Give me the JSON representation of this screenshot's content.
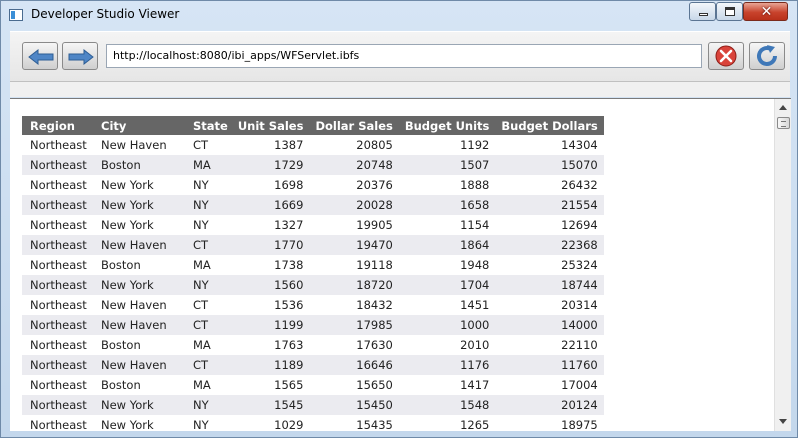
{
  "window": {
    "title": "Developer Studio Viewer"
  },
  "toolbar": {
    "url": "http://localhost:8080/ibi_apps/WFServlet.ibfs"
  },
  "colors": {
    "header_bg": "#666666",
    "row_alt": "#ebebf0",
    "close_red": "#c8432c"
  },
  "icons": {
    "back": "back-arrow-icon",
    "forward": "forward-arrow-icon",
    "stop": "stop-icon",
    "refresh": "refresh-icon"
  },
  "report": {
    "columns": [
      "Region",
      "City",
      "State",
      "Unit Sales",
      "Dollar Sales",
      "Budget Units",
      "Budget Dollars"
    ],
    "rows": [
      [
        "Northeast",
        "New Haven",
        "CT",
        "1387",
        "20805",
        "1192",
        "14304"
      ],
      [
        "Northeast",
        "Boston",
        "MA",
        "1729",
        "20748",
        "1507",
        "15070"
      ],
      [
        "Northeast",
        "New York",
        "NY",
        "1698",
        "20376",
        "1888",
        "26432"
      ],
      [
        "Northeast",
        "New York",
        "NY",
        "1669",
        "20028",
        "1658",
        "21554"
      ],
      [
        "Northeast",
        "New York",
        "NY",
        "1327",
        "19905",
        "1154",
        "12694"
      ],
      [
        "Northeast",
        "New Haven",
        "CT",
        "1770",
        "19470",
        "1864",
        "22368"
      ],
      [
        "Northeast",
        "Boston",
        "MA",
        "1738",
        "19118",
        "1948",
        "25324"
      ],
      [
        "Northeast",
        "New York",
        "NY",
        "1560",
        "18720",
        "1704",
        "18744"
      ],
      [
        "Northeast",
        "New Haven",
        "CT",
        "1536",
        "18432",
        "1451",
        "20314"
      ],
      [
        "Northeast",
        "New Haven",
        "CT",
        "1199",
        "17985",
        "1000",
        "14000"
      ],
      [
        "Northeast",
        "Boston",
        "MA",
        "1763",
        "17630",
        "2010",
        "22110"
      ],
      [
        "Northeast",
        "New Haven",
        "CT",
        "1189",
        "16646",
        "1176",
        "11760"
      ],
      [
        "Northeast",
        "Boston",
        "MA",
        "1565",
        "15650",
        "1417",
        "17004"
      ],
      [
        "Northeast",
        "New York",
        "NY",
        "1545",
        "15450",
        "1548",
        "20124"
      ],
      [
        "Northeast",
        "New York",
        "NY",
        "1029",
        "15435",
        "1265",
        "18975"
      ]
    ]
  }
}
